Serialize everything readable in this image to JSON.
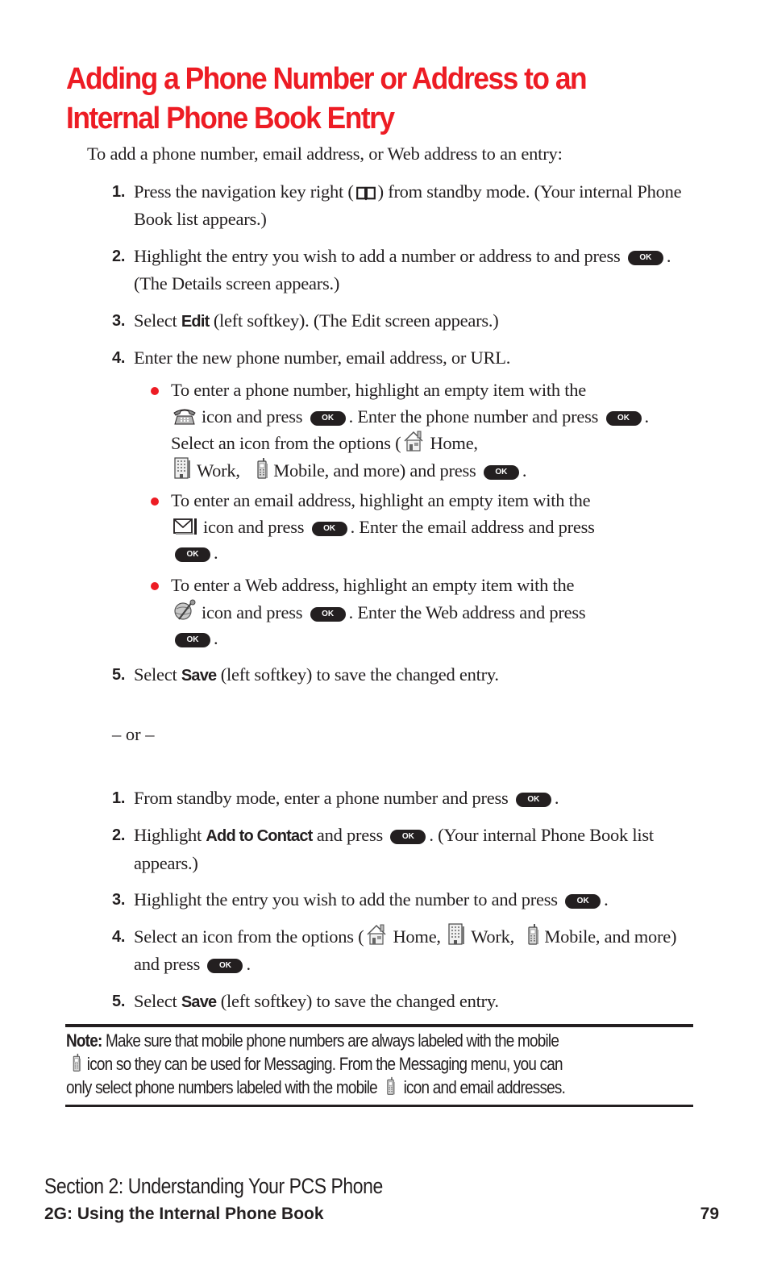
{
  "title": "Adding a Phone Number or Address to an Internal Phone Book Entry",
  "intro": "To add a phone number, email address, or Web address to an entry:",
  "ok_key_label": "OK",
  "accent_color": "#ed1c24",
  "procedure_a": {
    "steps": [
      {
        "num": "1.",
        "pre": "Press the navigation key right (",
        "icon": "phone-book-icon",
        "post": ") from standby mode. (Your internal Phone Book list appears.)"
      },
      {
        "num": "2.",
        "pre": "Highlight the entry you wish to add a number or address to and press",
        "post": ". (The Details screen appears.)"
      },
      {
        "num": "3.",
        "pre": "Select",
        "term": "Edit",
        "post": "(left softkey). (The Edit screen appears.)"
      },
      {
        "num": "4.",
        "text": "Enter the new phone number, email address, or URL."
      },
      {
        "num": "5.",
        "pre": "Select",
        "term": "Save",
        "post": "(left softkey) to save the changed entry."
      }
    ],
    "bullets": [
      {
        "a": "To enter a phone number, highlight an empty item with the",
        "b": "icon and press",
        "c": ". Enter the phone number and press",
        "d": ". Select an icon from the options (",
        "home": "Home,",
        "work": "Work,",
        "mobile": "Mobile, and more) and press",
        "end": "."
      },
      {
        "a": "To enter an email address, highlight an empty item with the",
        "b": "icon and press",
        "c": ". Enter the email address and press",
        "end": "."
      },
      {
        "a": "To enter a Web address, highlight an empty item with the",
        "b": "icon and press",
        "c": ". Enter the Web address and press",
        "end": "."
      }
    ]
  },
  "separator": "– or –",
  "procedure_b": {
    "steps": [
      {
        "num": "1.",
        "pre": "From standby mode, enter a phone number and press",
        "post": "."
      },
      {
        "num": "2.",
        "pre": "Highlight",
        "term": "Add to Contact",
        "mid": "and press",
        "post": ". (Your internal Phone Book list appears.)"
      },
      {
        "num": "3.",
        "pre": "Highlight the entry you wish to add the number to and press",
        "post": "."
      },
      {
        "num": "4.",
        "pre": "Select an icon from the options (",
        "home": "Home,",
        "work": "Work,",
        "mobile": "Mobile, and more) and press",
        "post": "."
      },
      {
        "num": "5.",
        "pre": "Select",
        "term": "Save",
        "post": "(left softkey) to save the changed entry."
      }
    ]
  },
  "note": {
    "label": "Note:",
    "line1": "Make sure that mobile phone numbers are always labeled with the mobile",
    "line2": "icon so they can be used for Messaging. From the Messaging menu, you can",
    "line3a": "only select phone numbers labeled with the mobile",
    "line3b": "icon and email addresses."
  },
  "footer": {
    "section": "Section 2: Understanding Your PCS Phone",
    "chapter": "2G: Using the Internal Phone Book",
    "page_number": "79"
  }
}
